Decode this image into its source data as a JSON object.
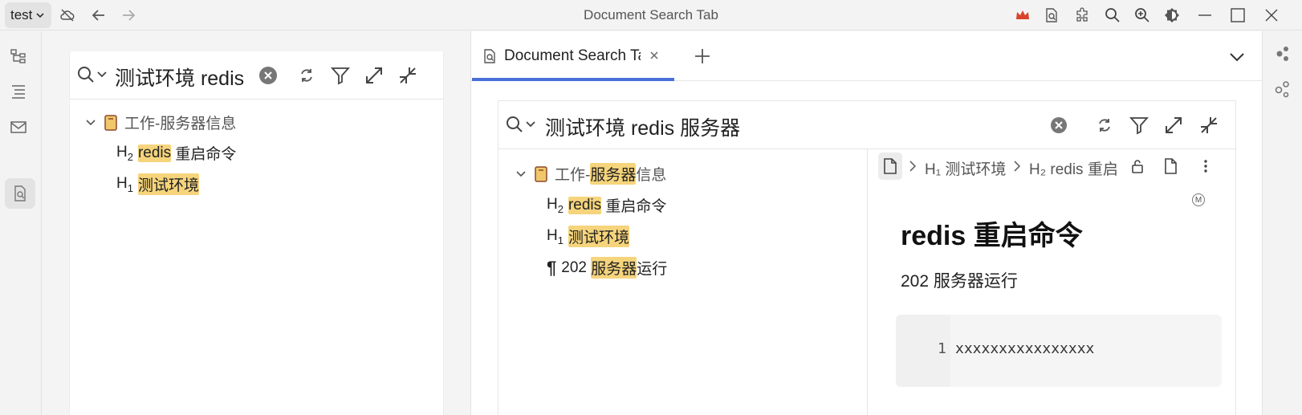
{
  "titlebar": {
    "workspace": "test",
    "title": "Document Search Tab"
  },
  "left_search": {
    "query": "测试环境 redis",
    "results": {
      "doc_title": "工作-服务器信息",
      "items": [
        {
          "heading": "H",
          "level": "2",
          "match": "redis",
          "rest": " 重启命令"
        },
        {
          "heading": "H",
          "level": "1",
          "match": "测试环境",
          "rest": ""
        }
      ]
    }
  },
  "tab": {
    "label": "Document Search Tab"
  },
  "doc_search": {
    "query": "测试环境 redis 服务器",
    "doc_title_pre": "工作-",
    "doc_title_match": "服务器",
    "doc_title_post": "信息",
    "items": [
      {
        "heading": "H",
        "level": "2",
        "pre": "",
        "match": "redis",
        "rest": " 重启命令"
      },
      {
        "heading": "H",
        "level": "1",
        "pre": "",
        "match": "测试环境",
        "rest": ""
      },
      {
        "heading": "¶",
        "level": "",
        "pre": "202 ",
        "match": "服务器",
        "rest": "运行"
      }
    ]
  },
  "preview": {
    "breadcrumb_1": "H₁ 测试环境",
    "breadcrumb_2": "H₂ redis 重启",
    "badge": "M",
    "heading": "redis 重启命令",
    "paragraph": "202 服务器运行",
    "code_line_no": "1",
    "code_line": "xxxxxxxxxxxxxxxx"
  },
  "colors": {
    "highlight": "#f5d47c",
    "tab_accent": "#4a6fd8",
    "crown": "#d9432b"
  }
}
